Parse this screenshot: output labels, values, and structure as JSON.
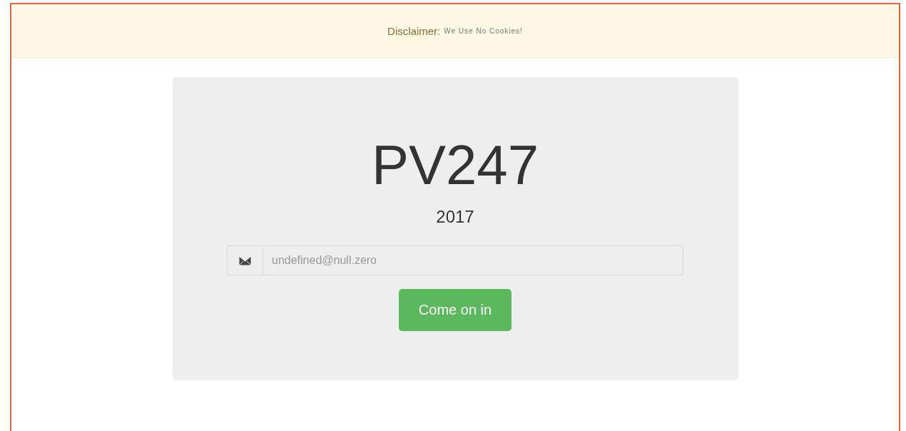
{
  "disclaimer": {
    "label": "Disclaimer:",
    "text": "We Use No Cookies!"
  },
  "card": {
    "title": "PV247",
    "subtitle": "2017",
    "email": {
      "placeholder": "undefined@null.zero"
    },
    "button": "Come on in"
  }
}
